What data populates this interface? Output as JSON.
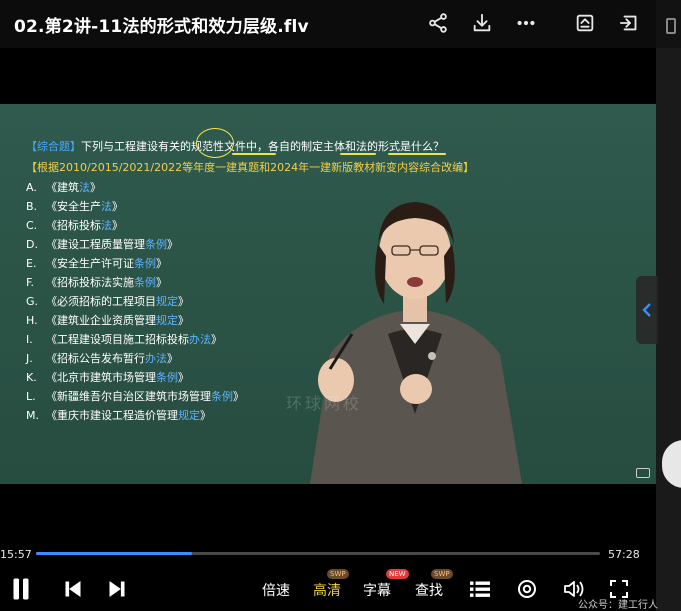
{
  "window": {
    "title": "02.第2讲-11法的形式和效力层级.flv"
  },
  "toolbar": {
    "icons": [
      "share-icon",
      "download-icon",
      "more-icon",
      "screenshot-icon",
      "exit-window-icon"
    ]
  },
  "slide": {
    "question_tag": "【综合题】",
    "question_text": "下列与工程建设有关的规范性文件中，各自的制定主体和法的形式是什么？",
    "source": "【根据2010/2015/2021/2022等年度一建真题和2024年一建新版教材新变内容综合改编】",
    "options": [
      {
        "letter": "A.",
        "prefix": "《建筑",
        "hl": "法",
        "suffix": "》"
      },
      {
        "letter": "B.",
        "prefix": "《安全生产",
        "hl": "法",
        "suffix": "》"
      },
      {
        "letter": "C.",
        "prefix": "《招标投标",
        "hl": "法",
        "suffix": "》"
      },
      {
        "letter": "D.",
        "prefix": "《建设工程质量管理",
        "hl": "条例",
        "suffix": "》"
      },
      {
        "letter": "E.",
        "prefix": "《安全生产许可证",
        "hl": "条例",
        "suffix": "》"
      },
      {
        "letter": "F.",
        "prefix": "《招标投标法实施",
        "hl": "条例",
        "suffix": "》"
      },
      {
        "letter": "G.",
        "prefix": "《必须招标的工程项目",
        "hl": "规定",
        "suffix": "》"
      },
      {
        "letter": "H.",
        "prefix": "《建筑业企业资质管理",
        "hl": "规定",
        "suffix": "》"
      },
      {
        "letter": "I.",
        "prefix": "《工程建设项目施工招标投标",
        "hl": "办法",
        "suffix": "》"
      },
      {
        "letter": "J.",
        "prefix": "《招标公告发布暂行",
        "hl": "办法",
        "suffix": "》"
      },
      {
        "letter": "K.",
        "prefix": "《北京市建筑市场管理",
        "hl": "条例",
        "suffix": "》"
      },
      {
        "letter": "L.",
        "prefix": "《新疆维吾尔自治区建筑市场管理",
        "hl": "条例",
        "suffix": "》"
      },
      {
        "letter": "M.",
        "prefix": "《重庆市建设工程造价管理",
        "hl": "规定",
        "suffix": "》"
      }
    ],
    "watermark": "环球网校"
  },
  "player": {
    "current_time": "15:57",
    "total_time": "57:28",
    "progress_fraction": 0.277,
    "speed_label": "倍速",
    "quality_label": "高清",
    "subtitle_label": "字幕",
    "search_label": "查找",
    "badge_swp": "SWP",
    "badge_new": "NEW"
  },
  "footer": {
    "note": "公众号：建工行人"
  },
  "colors": {
    "board": "#2b5246",
    "accent": "#3d8dff",
    "question_tag": "#4aa8ff",
    "source": "#f2d04a",
    "highlight": "#5fb2ff"
  }
}
